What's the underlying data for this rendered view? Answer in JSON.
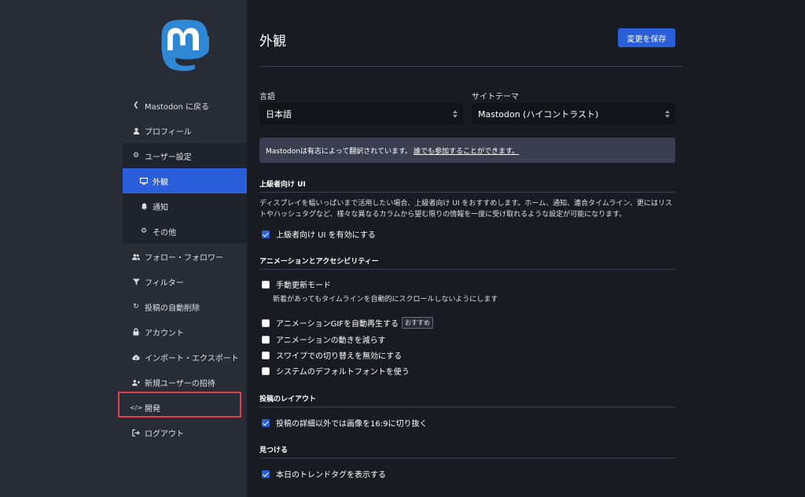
{
  "sidebar": {
    "back": "Mastodon に戻る",
    "items": [
      {
        "label": "プロフィール"
      },
      {
        "label": "ユーザー設定"
      },
      {
        "label": "外観"
      },
      {
        "label": "通知"
      },
      {
        "label": "その他"
      },
      {
        "label": "フォロー・フォロワー"
      },
      {
        "label": "フィルター"
      },
      {
        "label": "投稿の自動削除"
      },
      {
        "label": "アカウント"
      },
      {
        "label": "インポート・エクスポート"
      },
      {
        "label": "新規ユーザーの招待"
      },
      {
        "label": "開発"
      },
      {
        "label": "ログアウト"
      }
    ]
  },
  "header": {
    "title": "外観",
    "save_label": "変更を保存"
  },
  "fields": {
    "language_label": "言語",
    "language_value": "日本語",
    "theme_label": "サイトテーマ",
    "theme_value": "Mastodon (ハイコントラスト)"
  },
  "notice": {
    "text": "Mastodonは有志によって翻訳されています。",
    "link": "誰でも参加することができます。"
  },
  "sections": {
    "advanced": {
      "heading": "上級者向け UI",
      "desc": "ディスプレイを幅いっぱいまで活用したい場合、上級者向け UI をおすすめします。ホーム、通知、連合タイムライン、更にはリストやハッシュタグなど、様々な異なるカラムから望む限りの情報を一度に受け取れるような設定が可能になります。",
      "checkbox": "上級者向け UI を有効にする"
    },
    "animation": {
      "heading": "アニメーションとアクセシビリティー",
      "manual_refresh": "手動更新モード",
      "manual_refresh_hint": "新着があってもタイムラインを自動的にスクロールしないようにします",
      "autoplay_gif": "アニメーションGIFを自動再生する",
      "recommended": "おすすめ",
      "reduce_motion": "アニメーションの動きを減らす",
      "disable_swipe": "スワイプでの切り替えを無効にする",
      "system_font": "システムのデフォルトフォントを使う"
    },
    "layout": {
      "heading": "投稿のレイアウト",
      "crop_images": "投稿の詳細以外では画像を16:9に切り抜く"
    },
    "discovery": {
      "heading": "見つける",
      "trends": "本日のトレンドタグを表示する"
    }
  },
  "colors": {
    "accent": "#2b5fd9",
    "highlight": "#e0404a",
    "background": "#191b22",
    "sidebar": "#282c37"
  }
}
